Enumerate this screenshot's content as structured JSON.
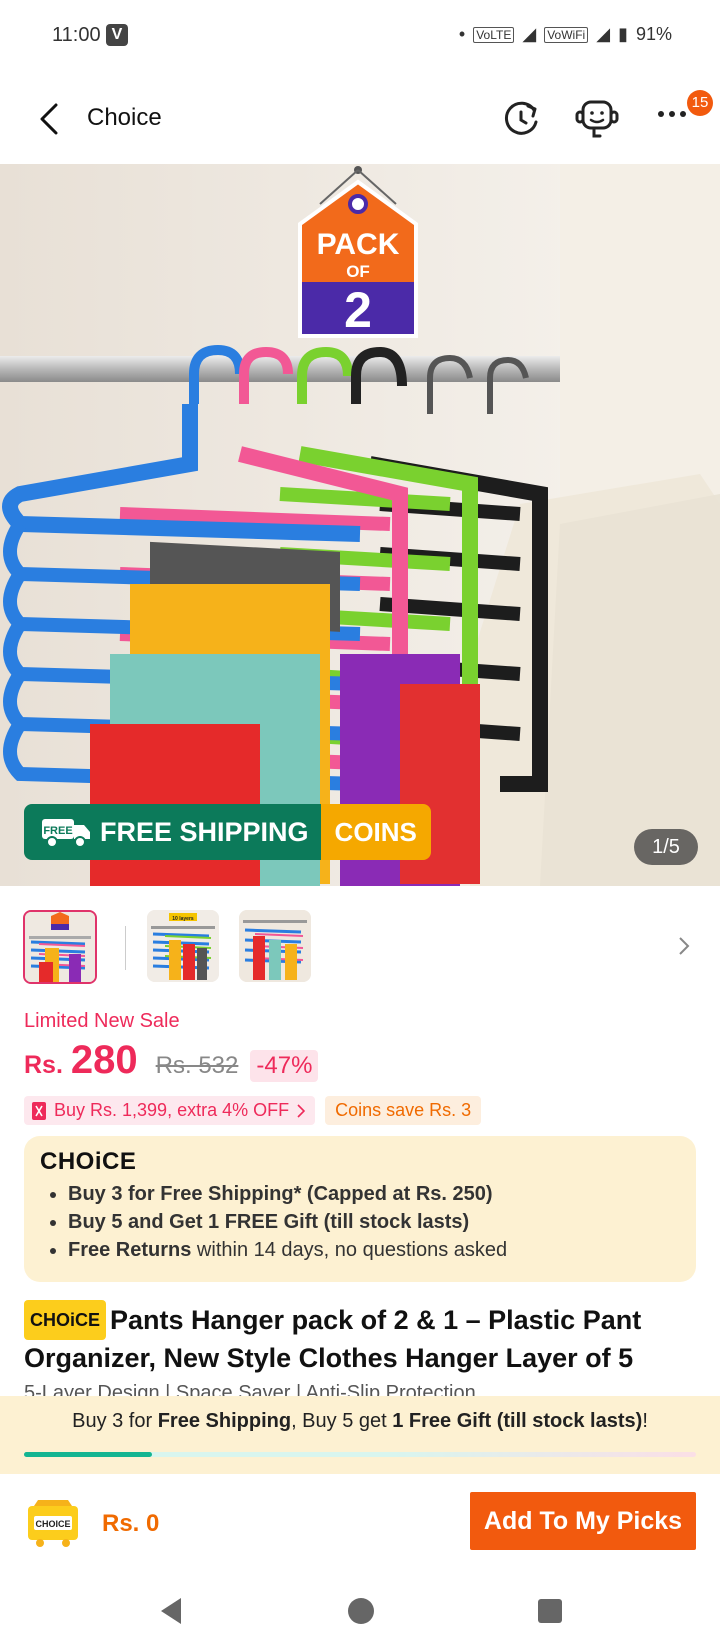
{
  "status_bar": {
    "time": "11:00",
    "v_badge": "V",
    "volte_1": "VoLTE",
    "volte_2": "VoWiFi",
    "battery": "91%"
  },
  "header": {
    "title": "Choice",
    "cart_badge": "15",
    "icons": [
      "back-icon",
      "history-icon",
      "support-icon",
      "more-icon"
    ]
  },
  "hero": {
    "pack_line1": "PACK",
    "pack_line2": "OF",
    "pack_number": "2",
    "free_label": "FREE",
    "free_shipping": "FREE SHIPPING",
    "coins": "COINS",
    "counter": "1/5",
    "colors": {
      "shipping_green": "#0c7a5a",
      "coins_yellow": "#f5a800",
      "tag_orange": "#f26a1b",
      "tag_purple": "#4b2aa8"
    }
  },
  "thumbs": {
    "badge_text": "10 layers"
  },
  "pricing": {
    "limited": "Limited New Sale",
    "currency": "Rs.",
    "price": "280",
    "old_price": "Rs. 532",
    "discount": "-47%",
    "promo_extra": "Buy Rs. 1,399, extra 4% OFF",
    "promo_coins": "Coins save Rs. 3",
    "accent": "#ee2a5a"
  },
  "choice_box": {
    "logo": "CHOiCE",
    "item1": "Buy 3 for  Free Shipping* (Capped at Rs. 250)",
    "item2": "Buy 5 and Get 1 FREE Gift (till stock lasts)",
    "item3_bold": "Free Returns",
    "item3_rest": " within 14 days, no questions asked"
  },
  "product": {
    "badge": "CHOiCE",
    "title": "Pants Hanger pack of 2 & 1 – Plastic Pant Organizer, New Style Clothes Hanger Layer of 5",
    "features": "5-Layer Design  |  Space Saver  |  Anti-Slip Protection"
  },
  "ship_promo": {
    "p1": "Buy 3 for ",
    "p2": "Free Shipping",
    "p3": ", Buy 5 get ",
    "p4": "1 Free Gift (till stock lasts)",
    "p5": "!",
    "progress": 0.19
  },
  "bottom_bar": {
    "basket_label": "CHOICE",
    "total": "Rs. 0",
    "button": "Add To My Picks",
    "button_color": "#f25a0e"
  }
}
